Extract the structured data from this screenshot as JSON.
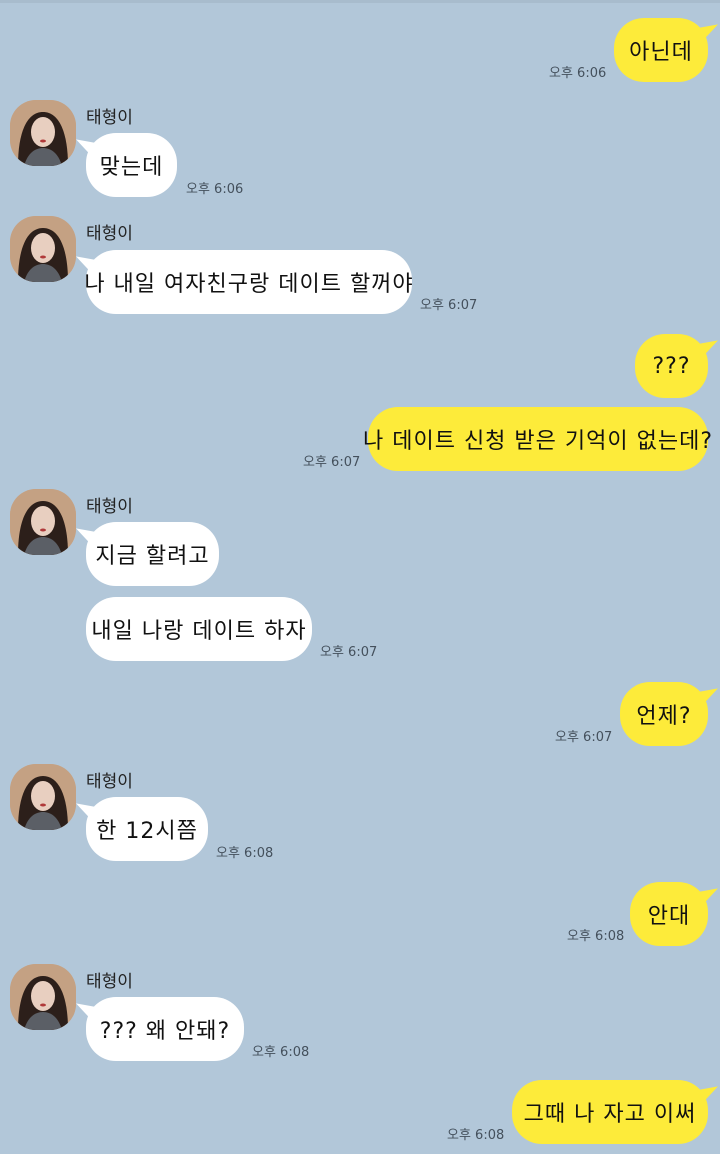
{
  "sender_name": "태형이",
  "messages": [
    {
      "text": "아닌데",
      "time": "오후 6:06"
    },
    {
      "text": "맞는데",
      "time": "오후 6:06"
    },
    {
      "text": "나 내일 여자친구랑 데이트 할꺼야",
      "time": "오후 6:07"
    },
    {
      "text": "???",
      "time": ""
    },
    {
      "text": "나 데이트 신청 받은 기억이 없는데?",
      "time": "오후 6:07"
    },
    {
      "text": "지금 할려고",
      "time": ""
    },
    {
      "text": "내일 나랑 데이트 하자",
      "time": "오후 6:07"
    },
    {
      "text": "언제?",
      "time": "오후 6:07"
    },
    {
      "text": "한 12시쯤",
      "time": "오후 6:08"
    },
    {
      "text": "안대",
      "time": "오후 6:08"
    },
    {
      "text": "??? 왜 안돼?",
      "time": "오후 6:08"
    },
    {
      "text": "그때 나 자고 이써",
      "time": "오후 6:08"
    }
  ],
  "colors": {
    "background": "#b2c7d9",
    "my_bubble": "#fdeb3a",
    "their_bubble": "#ffffff"
  },
  "icons": {
    "avatar": "profile-photo"
  }
}
